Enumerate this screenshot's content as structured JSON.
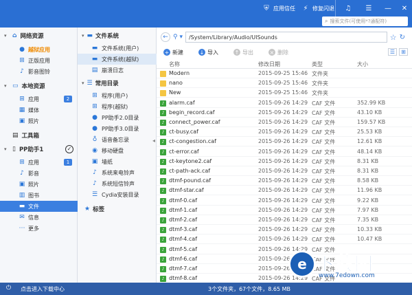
{
  "titlebar": {
    "trust": "应用信任",
    "fix": "修复闪退",
    "search_placeholder": "搜索文件(可使用*?通配符)",
    "min": "—",
    "close": "✕"
  },
  "left": {
    "sections": [
      {
        "label": "网络资源",
        "items": [
          {
            "label": "越狱应用",
            "accent": true
          },
          {
            "label": "正版应用"
          },
          {
            "label": "影音图铃"
          }
        ]
      },
      {
        "label": "本地资源",
        "items": [
          {
            "label": "应用",
            "badge": "2"
          },
          {
            "label": "媒体"
          },
          {
            "label": "照片"
          }
        ]
      },
      {
        "label": "工具箱",
        "items": []
      },
      {
        "label": "PP助手1",
        "items": [
          {
            "label": "应用",
            "badge": "1"
          },
          {
            "label": "影音"
          },
          {
            "label": "照片"
          },
          {
            "label": "图书"
          },
          {
            "label": "文件",
            "selected": true
          },
          {
            "label": "信息"
          },
          {
            "label": "更多"
          }
        ]
      }
    ]
  },
  "mid": {
    "fs_title": "文件系统",
    "fs_items": [
      "文件系统(用户)",
      "文件系统(越狱)",
      "崩溃日志"
    ],
    "common_title": "常用目录",
    "common_items": [
      "程序(用户)",
      "程序(越狱)",
      "PP助手2.0目录",
      "PP助手3.0目录",
      "语音备忘录",
      "移动硬盘",
      "墙纸",
      "系统来电铃声",
      "系统短信铃声",
      "Cydia安装目录"
    ],
    "tags_title": "标签"
  },
  "main": {
    "path": "/System/Library/Audio/UISounds",
    "toolbar": {
      "new": "新建",
      "import": "导入",
      "export": "导出",
      "delete": "删除"
    },
    "columns": {
      "name": "名称",
      "date": "修改日期",
      "type": "类型",
      "size": "大小"
    },
    "rows": [
      {
        "name": "Modern",
        "date": "2015-09-25 15:46",
        "type": "文件夹",
        "size": "",
        "folder": true
      },
      {
        "name": "nano",
        "date": "2015-09-25 15:46",
        "type": "文件夹",
        "size": "",
        "folder": true
      },
      {
        "name": "New",
        "date": "2015-09-25 15:46",
        "type": "文件夹",
        "size": "",
        "folder": true
      },
      {
        "name": "alarm.caf",
        "date": "2015-09-26 14:29",
        "type": "CAF 文件",
        "size": "352.99 KB"
      },
      {
        "name": "begin_record.caf",
        "date": "2015-09-26 14:29",
        "type": "CAF 文件",
        "size": "43.10 KB"
      },
      {
        "name": "connect_power.caf",
        "date": "2015-09-26 14:29",
        "type": "CAF 文件",
        "size": "159.57 KB"
      },
      {
        "name": "ct-busy.caf",
        "date": "2015-09-26 14:29",
        "type": "CAF 文件",
        "size": "25.53 KB"
      },
      {
        "name": "ct-congestion.caf",
        "date": "2015-09-26 14:29",
        "type": "CAF 文件",
        "size": "12.61 KB"
      },
      {
        "name": "ct-error.caf",
        "date": "2015-09-26 14:29",
        "type": "CAF 文件",
        "size": "48.14 KB"
      },
      {
        "name": "ct-keytone2.caf",
        "date": "2015-09-26 14:29",
        "type": "CAF 文件",
        "size": "8.31 KB"
      },
      {
        "name": "ct-path-ack.caf",
        "date": "2015-09-26 14:29",
        "type": "CAF 文件",
        "size": "8.31 KB"
      },
      {
        "name": "dtmf-pound.caf",
        "date": "2015-09-26 14:29",
        "type": "CAF 文件",
        "size": "8.58 KB"
      },
      {
        "name": "dtmf-star.caf",
        "date": "2015-09-26 14:29",
        "type": "CAF 文件",
        "size": "11.96 KB"
      },
      {
        "name": "dtmf-0.caf",
        "date": "2015-09-26 14:29",
        "type": "CAF 文件",
        "size": "9.22 KB"
      },
      {
        "name": "dtmf-1.caf",
        "date": "2015-09-26 14:29",
        "type": "CAF 文件",
        "size": "7.97 KB"
      },
      {
        "name": "dtmf-2.caf",
        "date": "2015-09-26 14:29",
        "type": "CAF 文件",
        "size": "7.35 KB"
      },
      {
        "name": "dtmf-3.caf",
        "date": "2015-09-26 14:29",
        "type": "CAF 文件",
        "size": "10.33 KB"
      },
      {
        "name": "dtmf-4.caf",
        "date": "2015-09-26 14:29",
        "type": "CAF 文件",
        "size": "10.47 KB"
      },
      {
        "name": "dtmf-5.caf",
        "date": "2015-09-26 14:29",
        "type": "CAF 文件",
        "size": ""
      },
      {
        "name": "dtmf-6.caf",
        "date": "2015-09-26 14:29",
        "type": "CAF 文件",
        "size": ""
      },
      {
        "name": "dtmf-7.caf",
        "date": "2015-09-26 14:29",
        "type": "CAF 文件",
        "size": ""
      },
      {
        "name": "dtmf-8.caf",
        "date": "2015-09-26 14:29",
        "type": "CAF 文件",
        "size": ""
      }
    ]
  },
  "footer": {
    "download": "点击进入下载中心",
    "status": "3个文件夹，67个文件，8.65 MB"
  },
  "watermark": {
    "title": "下载园",
    "letter": "e",
    "url": "www.7edown.com"
  },
  "colors": {
    "accent": "#2a6fd3",
    "selected": "#3b7fe0",
    "footer": "#2f5ea8"
  }
}
